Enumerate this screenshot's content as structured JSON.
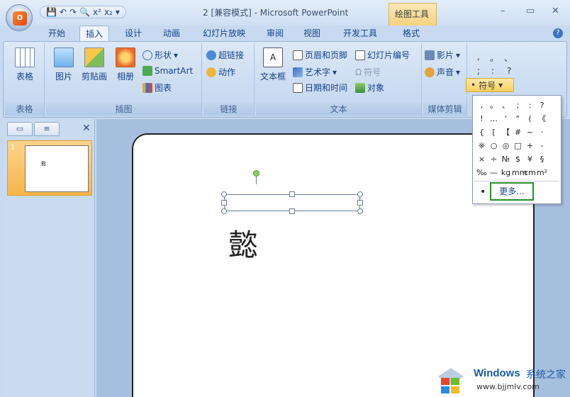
{
  "titlebar": {
    "office_logo": "Office",
    "qat_items": [
      "save-icon",
      "undo-icon",
      "redo-icon",
      "preview-icon",
      "superscript-icon",
      "subscript-icon"
    ],
    "qat_glyphs": [
      "💾",
      "↶",
      "↷",
      "🔍",
      "x²",
      "x₂",
      "▾"
    ],
    "title": "2 [兼容模式] - Microsoft PowerPoint",
    "context_tab": "绘图工具",
    "controls": [
      "–",
      "▭",
      "✕"
    ]
  },
  "tabs": {
    "items": [
      "开始",
      "插入",
      "设计",
      "动画",
      "幻灯片放映",
      "审阅",
      "视图",
      "开发工具",
      "格式"
    ],
    "active": "插入"
  },
  "ribbon": {
    "groups": {
      "table": {
        "label": "表格",
        "buttons": [
          "表格"
        ]
      },
      "illustrations": {
        "label": "插图",
        "buttons": [
          "图片",
          "剪贴画",
          "相册"
        ],
        "small": [
          "形状",
          "SmartArt",
          "图表"
        ]
      },
      "links": {
        "label": "链接",
        "small": [
          "超链接",
          "动作"
        ]
      },
      "text": {
        "label": "文本",
        "big": "文本框",
        "small": [
          "页眉和页脚",
          "艺术字",
          "日期和时间",
          "幻灯片编号",
          "符号",
          "对象"
        ]
      },
      "media": {
        "label": "媒体剪辑",
        "small": [
          "影片",
          "声音"
        ]
      }
    },
    "special_chars_mini": [
      ",",
      "。",
      "、",
      ";",
      ":",
      "?"
    ],
    "symbol_button": "符号"
  },
  "left_pane": {
    "tabs": [
      "slides-tab",
      "outline-tab"
    ],
    "slide_number": "1",
    "thumb_char": "懿"
  },
  "slide": {
    "char": "懿"
  },
  "symbol_dropdown": {
    "symbols": [
      ",",
      "。",
      "、",
      ";",
      ":",
      "?",
      "",
      "!",
      "…",
      "‘",
      "“",
      "(",
      "《",
      "",
      "{",
      "[",
      "【",
      "#",
      "~",
      "·",
      "",
      "※",
      "○",
      "◎",
      "□",
      "+",
      "-",
      "",
      "×",
      "÷",
      "№",
      "$",
      "¥",
      "§",
      "",
      "‰",
      "—",
      "kg",
      "mm",
      "cm",
      "m²",
      ""
    ],
    "bullet": "•",
    "more_label": "更多..."
  },
  "watermark": {
    "brand": "Windows",
    "suffix": "系统之家",
    "url": "www.bjjmlv.com"
  }
}
